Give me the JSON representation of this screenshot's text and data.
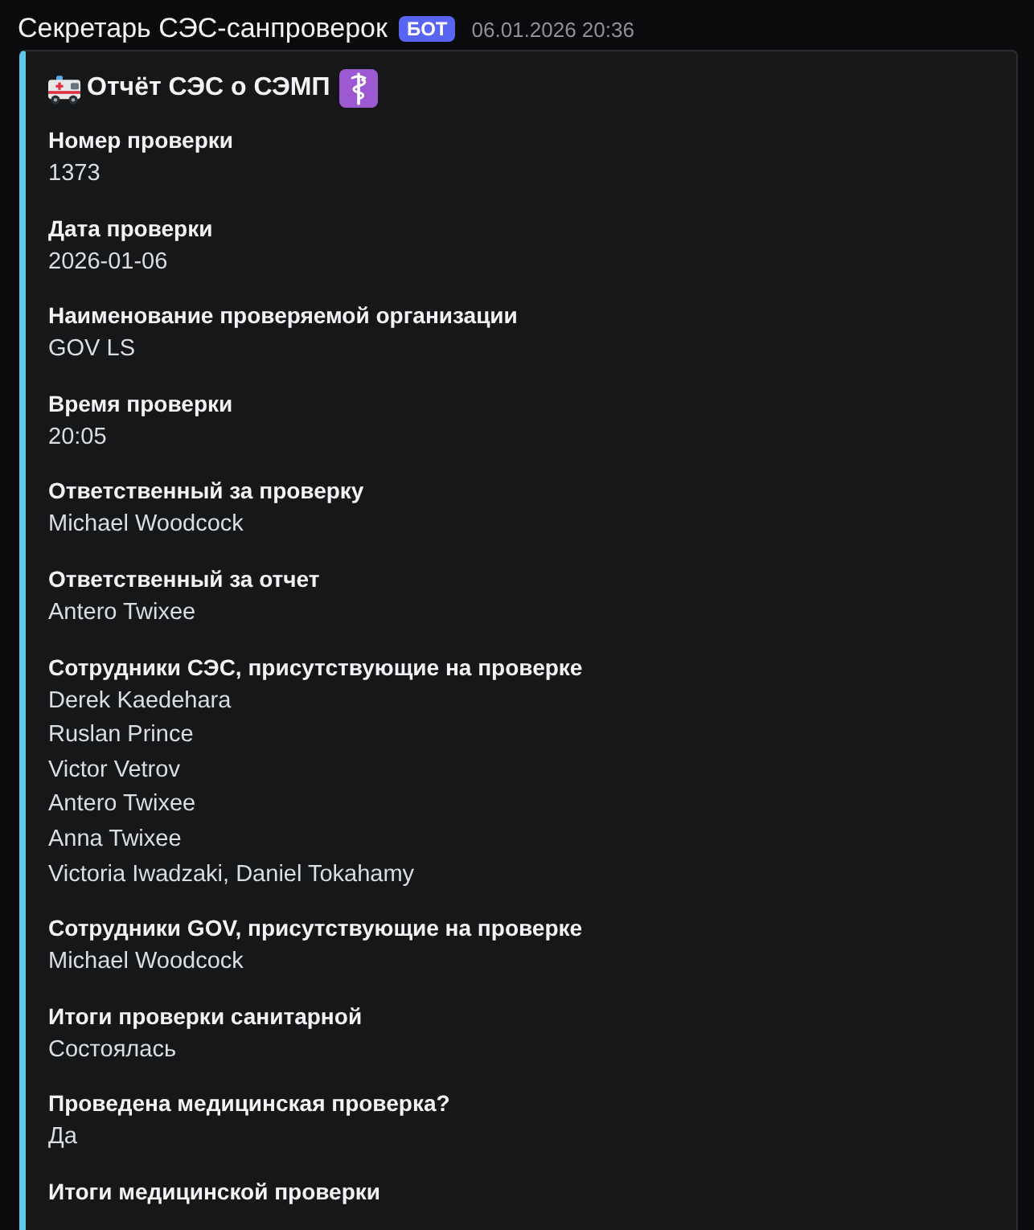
{
  "author": {
    "name": "Секретарь СЭС-санпроверок",
    "badge": "БОТ",
    "timestamp": "06.01.2026 20:36"
  },
  "embed": {
    "title": "Отчёт СЭС о СЭМП",
    "fields": [
      {
        "name": "Номер проверки",
        "lines": [
          "1373"
        ]
      },
      {
        "name": "Дата проверки",
        "lines": [
          "2026-01-06"
        ]
      },
      {
        "name": "Наименование проверяемой организации",
        "lines": [
          "GOV LS"
        ]
      },
      {
        "name": "Время проверки",
        "lines": [
          "20:05"
        ]
      },
      {
        "name": "Ответственный за проверку",
        "lines": [
          "Michael Woodcock"
        ]
      },
      {
        "name": "Ответственный за отчет",
        "lines": [
          "Antero Twixee"
        ]
      },
      {
        "name": "Сотрудники СЭС, присутствующие на проверке",
        "lines": [
          "Derek Kaedehara",
          "Ruslan Prince",
          "Victor Vetrov",
          "Antero Twixee",
          "Anna Twixee",
          "Victoria Iwadzaki, Daniel Tokahamy"
        ]
      },
      {
        "name": "Сотрудники GOV, присутствующие на проверке",
        "lines": [
          "Michael Woodcock"
        ]
      },
      {
        "name": "Итоги проверки санитарной",
        "lines": [
          "Состоялась"
        ]
      },
      {
        "name": "Проведена медицинская проверка?",
        "lines": [
          "Да"
        ]
      },
      {
        "name": "Итоги медицинской проверки"
      }
    ]
  }
}
